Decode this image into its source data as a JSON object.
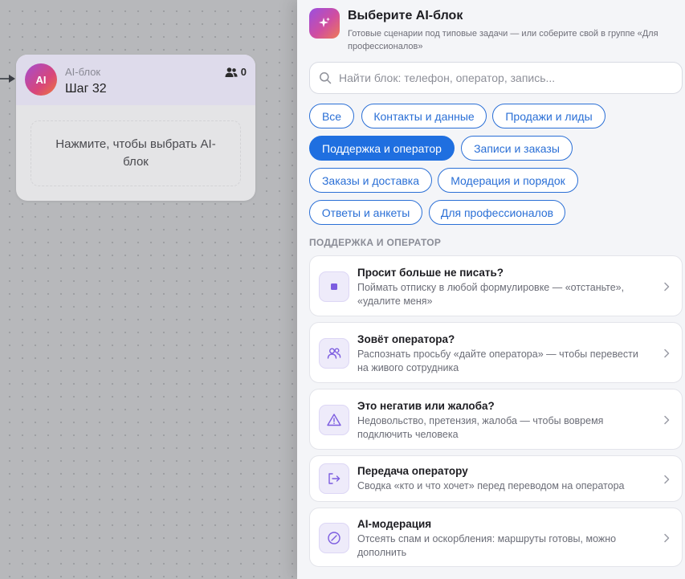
{
  "canvas": {
    "node": {
      "avatar_text": "AI",
      "type_label": "AI-блок",
      "title": "Шаг 32",
      "users_count": "0",
      "placeholder": "Нажмите, чтобы выбрать AI-блок"
    }
  },
  "panel": {
    "title": "Выберите AI-блок",
    "subtitle": "Готовые сценарии под типовые задачи — или соберите свой в группе «Для профессионалов»",
    "search_placeholder": "Найти блок: телефон, оператор, запись...",
    "filters": [
      {
        "label": "Все",
        "active": false
      },
      {
        "label": "Контакты и данные",
        "active": false
      },
      {
        "label": "Продажи и лиды",
        "active": false
      },
      {
        "label": "Поддержка и оператор",
        "active": true
      },
      {
        "label": "Записи и заказы",
        "active": false
      },
      {
        "label": "Заказы и доставка",
        "active": false
      },
      {
        "label": "Модерация и порядок",
        "active": false
      },
      {
        "label": "Ответы и анкеты",
        "active": false
      },
      {
        "label": "Для профессионалов",
        "active": false
      }
    ],
    "section_label": "ПОДДЕРЖКА И ОПЕРАТОР",
    "cards": [
      {
        "icon": "stop-square-icon",
        "title": "Просит больше не писать?",
        "description": "Поймать отписку в любой формулировке — «отстаньте», «удалите меня»"
      },
      {
        "icon": "users-icon",
        "title": "Зовёт оператора?",
        "description": "Распознать просьбу «дайте оператора» — чтобы перевести на живого сотрудника"
      },
      {
        "icon": "warning-triangle-icon",
        "title": "Это негатив или жалоба?",
        "description": "Недовольство, претензия, жалоба — чтобы вовремя подключить человека"
      },
      {
        "icon": "handoff-icon",
        "title": "Передача оператору",
        "description": "Сводка «кто и что хочет» перед переводом на оператора"
      },
      {
        "icon": "block-circle-icon",
        "title": "AI-модерация",
        "description": "Отсеять спам и оскорбления: маршруты готовы, можно дополнить"
      }
    ]
  },
  "colors": {
    "accent": "#1f6fe0",
    "icon_tint": "#7c5ce0",
    "panel_bg": "#f4f5f8"
  }
}
